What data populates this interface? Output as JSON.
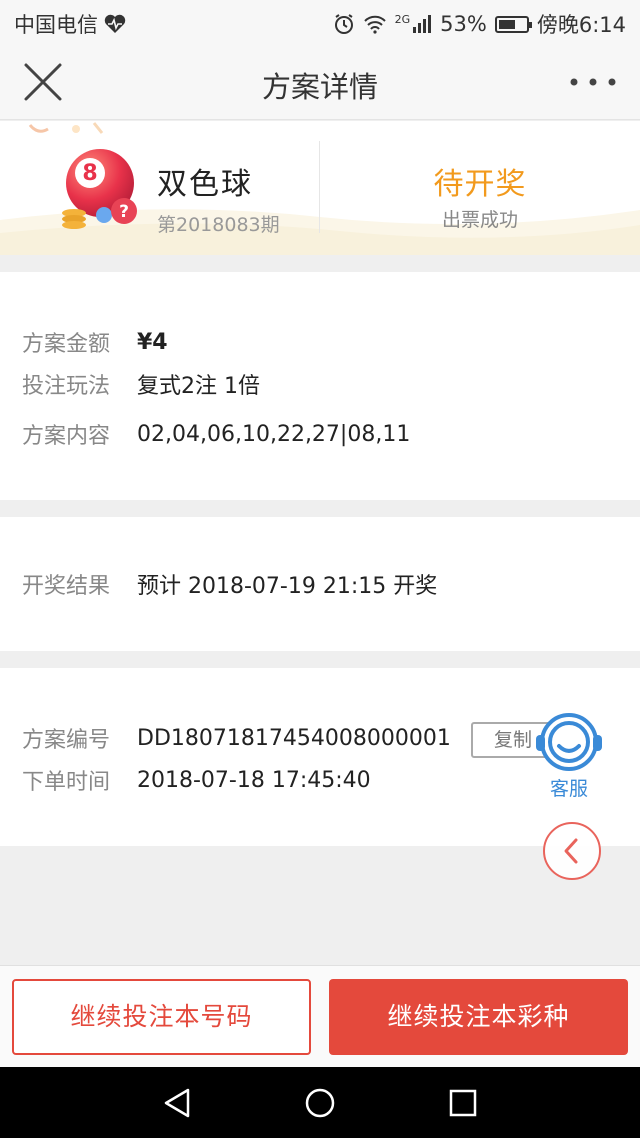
{
  "status_bar": {
    "carrier": "中国电信",
    "battery": "53%",
    "time": "傍晚6:14",
    "network": "2G"
  },
  "nav": {
    "title": "方案详情"
  },
  "header": {
    "lottery_badge": "8",
    "lottery_name": "双色球",
    "issue": "第2018083期",
    "status": "待开奖",
    "sub_status": "出票成功"
  },
  "plan": {
    "amount_label": "方案金额",
    "amount_value": "¥4",
    "play_label": "投注玩法",
    "play_value": "复式2注 1倍",
    "content_label": "方案内容",
    "content_value": "02,04,06,10,22,27|08,11"
  },
  "draw": {
    "result_label": "开奖结果",
    "result_value": "预计 2018-07-19 21:15 开奖"
  },
  "order": {
    "id_label": "方案编号",
    "id_value": "DD18071817454008000001",
    "copy_label": "复制",
    "time_label": "下单时间",
    "time_value": "2018-07-18 17:45:40"
  },
  "widgets": {
    "kefu_label": "客服"
  },
  "actions": {
    "continue_number": "继续投注本号码",
    "continue_lottery": "继续投注本彩种"
  },
  "colors": {
    "accent_red": "#e4493c",
    "status_orange": "#f29a1d",
    "kefu_blue": "#3a8ad7"
  }
}
